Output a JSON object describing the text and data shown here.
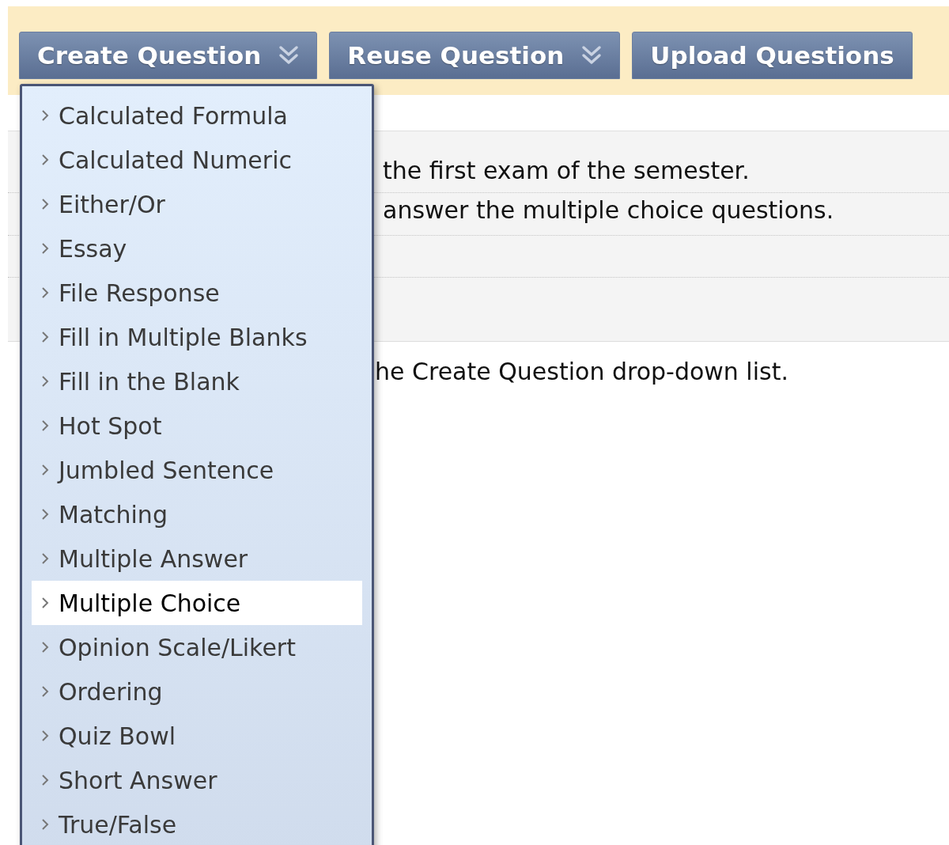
{
  "toolbar": {
    "buttons": [
      {
        "label": "Create Question",
        "dropdown": true
      },
      {
        "label": "Reuse Question",
        "dropdown": true
      },
      {
        "label": "Upload Questions",
        "dropdown": false
      }
    ]
  },
  "menu": {
    "items": [
      {
        "label": "Calculated Formula",
        "selected": false
      },
      {
        "label": "Calculated Numeric",
        "selected": false
      },
      {
        "label": "Either/Or",
        "selected": false
      },
      {
        "label": "Essay",
        "selected": false
      },
      {
        "label": "File Response",
        "selected": false
      },
      {
        "label": "Fill in Multiple Blanks",
        "selected": false
      },
      {
        "label": "Fill in the Blank",
        "selected": false
      },
      {
        "label": "Hot Spot",
        "selected": false
      },
      {
        "label": "Jumbled Sentence",
        "selected": false
      },
      {
        "label": "Matching",
        "selected": false
      },
      {
        "label": "Multiple Answer",
        "selected": false
      },
      {
        "label": "Multiple Choice",
        "selected": true
      },
      {
        "label": "Opinion Scale/Likert",
        "selected": false
      },
      {
        "label": "Ordering",
        "selected": false
      },
      {
        "label": "Quiz Bowl",
        "selected": false
      },
      {
        "label": "Short Answer",
        "selected": false
      },
      {
        "label": "True/False",
        "selected": false
      }
    ]
  },
  "content": {
    "rows": [
      {
        "text": "the first exam of the semester."
      },
      {
        "text": "answer the multiple choice questions."
      }
    ],
    "note": "he Create Question drop-down list."
  }
}
